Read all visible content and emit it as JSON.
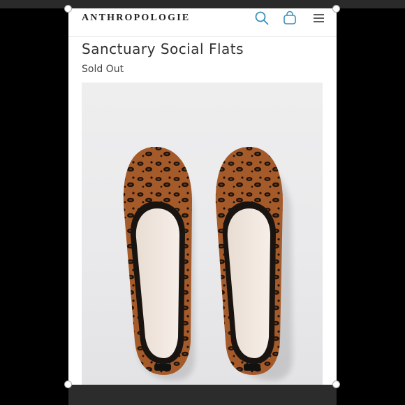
{
  "header": {
    "logo": "ANTHROPOLOGIE",
    "icons": {
      "search": "search-icon",
      "bag": "shopping-bag-icon",
      "menu": "hamburger-menu-icon"
    }
  },
  "product": {
    "title": "Sanctuary Social Flats",
    "status": "Sold Out",
    "image": "leopard-print-ballet-flats"
  },
  "colors": {
    "accent": "#3b8fb8",
    "text": "#333333"
  }
}
